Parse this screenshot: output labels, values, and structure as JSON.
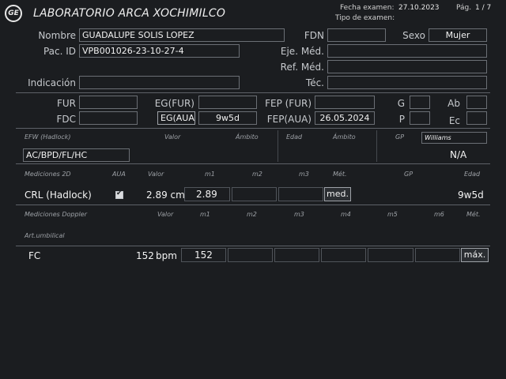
{
  "header": {
    "logo": "GE",
    "title": "LABORATORIO ARCA XOCHIMILCO",
    "exam_date_label": "Fecha examen:",
    "exam_date": "27.10.2023",
    "exam_type_label": "Tipo de examen:",
    "exam_type": "",
    "page_label": "Pág.",
    "page": "1 / 7"
  },
  "patient": {
    "name_label": "Nombre",
    "name": "GUADALUPE SOLIS LOPEZ",
    "dob_label": "FDN",
    "dob": "",
    "sex_label": "Sexo",
    "sex": "Mujer",
    "id_label": "Pac. ID",
    "id": "VPB001026-23-10-27-4",
    "exec_doctor_label": "Eje. Méd.",
    "exec_doctor": "",
    "ref_doctor_label": "Ref. Méd.",
    "ref_doctor": "",
    "indication_label": "Indicación",
    "indication": "",
    "tech_label": "Téc.",
    "tech": ""
  },
  "dates": {
    "fur_label": "FUR",
    "fur": "",
    "egfur_label": "EG(FUR)",
    "egfur": "",
    "fepfur_label": "FEP (FUR)",
    "fepfur": "",
    "g_label": "G",
    "g": "",
    "ab_label": "Ab",
    "ab": "",
    "fdc_label": "FDC",
    "fdc": "",
    "egaua_label": "EG(AUA)",
    "egaua": "9w5d",
    "fepaua_label": "FEP(AUA)",
    "fepaua": "26.05.2024",
    "p_label": "P",
    "p": "",
    "ec_label": "Ec",
    "ec": ""
  },
  "efw": {
    "label": "EFW (Hadlock)",
    "col_valor": "Valor",
    "col_ambito": "Ámbito",
    "col_edad": "Edad",
    "col_ambito2": "Ámbito",
    "col_gp": "GP",
    "gp_method": "Williams",
    "formula": "AC/BPD/FL/HC",
    "gp_value": "N/A"
  },
  "m2d": {
    "label": "Mediciones 2D",
    "col_aua": "AUA",
    "col_valor": "Valor",
    "col_m1": "m1",
    "col_m2": "m2",
    "col_m3": "m3",
    "col_met": "Mét.",
    "col_gp": "GP",
    "col_edad": "Edad",
    "row": {
      "name": "CRL (Hadlock)",
      "aua_checked": "true",
      "check_mark": "✔",
      "value": "2.89 cm",
      "m1": "2.89",
      "m2": "",
      "m3": "",
      "method": "med.",
      "age": "9w5d"
    }
  },
  "doppler": {
    "label": "Mediciones Doppler",
    "col_valor": "Valor",
    "col_m1": "m1",
    "col_m2": "m2",
    "col_m3": "m3",
    "col_m4": "m4",
    "col_m5": "m5",
    "col_m6": "m6",
    "col_met": "Mét.",
    "section": "Art.umbilical",
    "row": {
      "name": "FC",
      "value": "152",
      "unit": "bpm",
      "m1": "152",
      "m2": "",
      "m3": "",
      "m4": "",
      "m5": "",
      "m6": "",
      "method": "máx."
    }
  }
}
